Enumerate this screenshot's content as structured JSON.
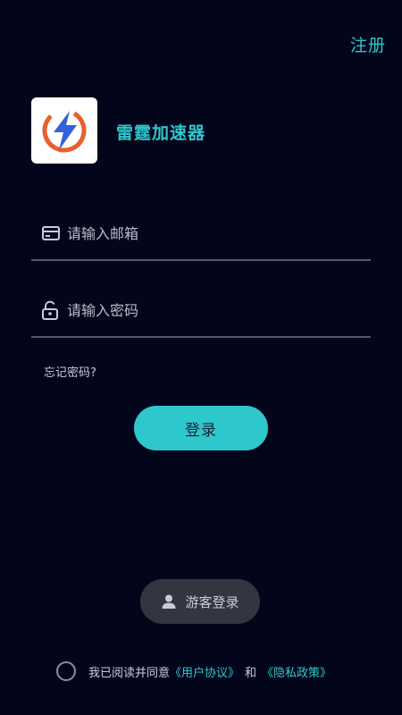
{
  "header": {
    "register_label": "注册"
  },
  "app": {
    "name": "雷霆加速器",
    "logo_icon": "lightning-bolt-logo"
  },
  "form": {
    "email": {
      "placeholder": "请输入邮箱",
      "value": "",
      "icon": "card-icon"
    },
    "password": {
      "placeholder": "请输入密码",
      "value": "",
      "icon": "unlock-icon"
    },
    "forgot_label": "忘记密码?",
    "login_label": "登录"
  },
  "guest": {
    "label": "游客登录",
    "icon": "user-icon"
  },
  "agreement": {
    "prefix": "我已阅读并同意",
    "user_agreement": "《用户协议》",
    "and": "和",
    "privacy_policy": "《隐私政策》",
    "checked": false
  },
  "colors": {
    "background": "#03061b",
    "accent": "#2ec7cc",
    "logo_orange": "#e8602c",
    "logo_blue": "#2f63d8",
    "guest_button": "#333641",
    "divider": "#545865"
  }
}
